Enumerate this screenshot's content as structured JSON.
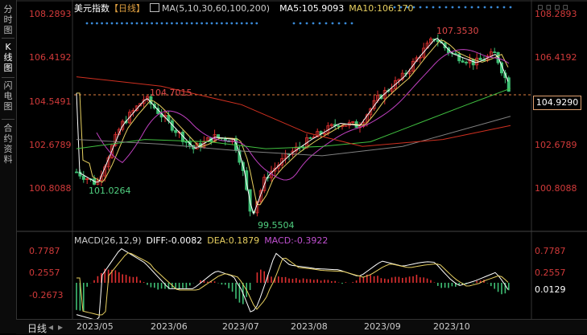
{
  "sidebar": {
    "buttons": [
      {
        "label": "分时图"
      },
      {
        "label": "K线图"
      },
      {
        "label": "闪电图"
      },
      {
        "label": "合约资料"
      }
    ]
  },
  "header": {
    "title": "美元指数",
    "period": "【日线】",
    "ma_label": "MA(5,10,30,60,100,200)",
    "ma5": "MA5:105.9093",
    "ma10": "MA10:106.170"
  },
  "price_axis": {
    "left": [
      "108.2893",
      "106.4192",
      "104.5491",
      "102.6789",
      "100.8088"
    ],
    "right": [
      "108.2893",
      "106.4192",
      "104.9290",
      "102.6789",
      "100.8088"
    ],
    "current": "104.9290"
  },
  "annotations": {
    "high": "107.3530",
    "prev_high": "104.7015",
    "low1": "101.0264",
    "low2": "99.5504"
  },
  "macd": {
    "label": "MACD(26,12,9)",
    "diff": "DIFF:-0.0082",
    "dea": "DEA:0.1879",
    "macd": "MACD:-0.3922",
    "axis_left": [
      "0.7787",
      "0.2557",
      "-0.2673"
    ],
    "axis_right": [
      "0.7787",
      "0.2557",
      "0.0129"
    ]
  },
  "x_axis": [
    "2023/05",
    "2023/06",
    "2023/07",
    "2023/08",
    "2023/09",
    "2023/10"
  ],
  "bottom": {
    "period_label": "日线"
  },
  "colors": {
    "up": "#e03030",
    "down": "#3fbf74",
    "ma5": "#ffffff",
    "ma10": "#e8d060",
    "ma30": "#c040c0",
    "ma60": "#40c040",
    "ma100": "#808080",
    "ma200": "#d03020"
  }
}
